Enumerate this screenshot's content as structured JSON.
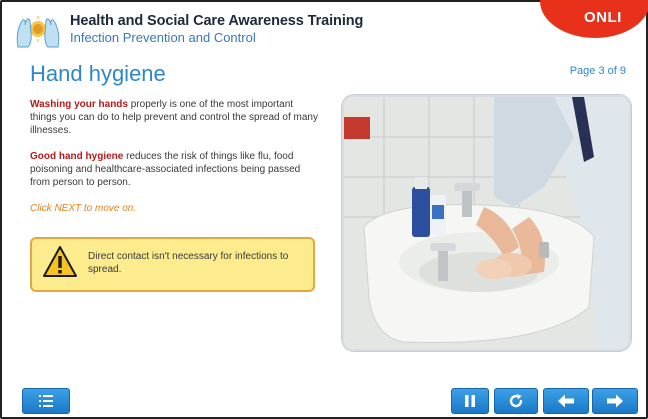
{
  "header": {
    "title": "Health and Social Care Awareness Training",
    "subtitle": "Infection Prevention and Control",
    "badge": "ONLI"
  },
  "page": {
    "title": "Hand hygiene",
    "number": "Page 3 of 9"
  },
  "content": {
    "para1_em": "Washing your hands",
    "para1_rest": " properly is one of the most important things you can do to help prevent and control the spread of many illnesses.",
    "para2_em": "Good hand hygiene",
    "para2_rest": " reduces the risk of things like flu, food poisoning and healthcare-associated infections being passed from person to person.",
    "hint": "Click NEXT to move on."
  },
  "warning": {
    "text": "Direct contact isn't necessary for infections to spread."
  },
  "image": {
    "subject": "hand-washing-photo"
  },
  "controls": {
    "menu_icon": "menu-list-icon",
    "pause_icon": "pause-icon",
    "replay_icon": "replay-icon",
    "back_icon": "arrow-left-icon",
    "next_icon": "arrow-right-icon"
  },
  "colors": {
    "accent": "#2e88c8",
    "badge": "#e8311a",
    "emphasis": "#b51a1a",
    "hint": "#e0821f",
    "warning_bg": "#fcec8e",
    "warning_border": "#e8a640",
    "button": "#1a78c8"
  }
}
